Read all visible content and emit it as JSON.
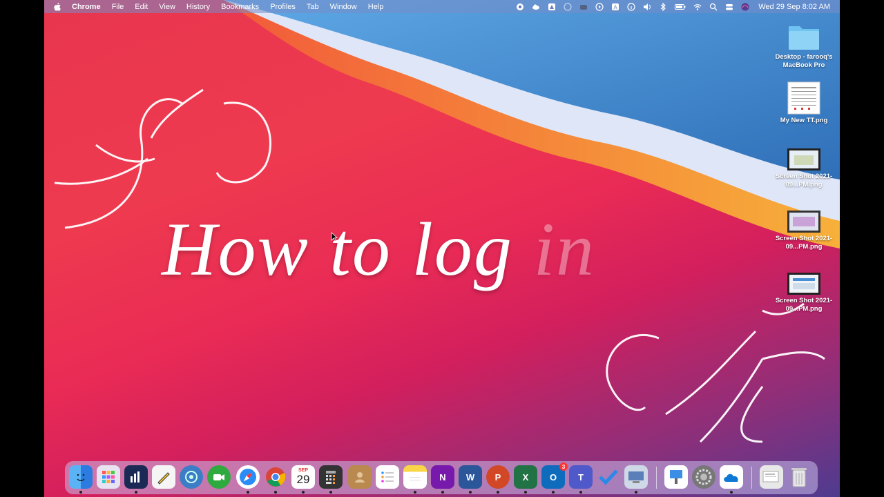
{
  "menubar": {
    "app_name": "Chrome",
    "items": [
      "File",
      "Edit",
      "View",
      "History",
      "Bookmarks",
      "Profiles",
      "Tab",
      "Window",
      "Help"
    ],
    "clock": "Wed 29 Sep  8:02 AM"
  },
  "desktop_icons": [
    {
      "label": "Desktop - farooq's MacBook Pro",
      "icon": "folder-icon"
    },
    {
      "label": "My New TT.png",
      "icon": "image-file-icon"
    },
    {
      "label": "Screen Shot 2021-09...PM.png",
      "icon": "screenshot-file-icon"
    },
    {
      "label": "Screen Shot 2021-09...PM.png",
      "icon": "screenshot-file-icon"
    },
    {
      "label": "Screen Shot 2021-09...PM.png",
      "icon": "screenshot-file-icon"
    }
  ],
  "headline": {
    "main": "How to log ",
    "faded": "in"
  },
  "dock": {
    "calendar_month": "SEP",
    "calendar_day": "29",
    "outlook_badge": "3",
    "apps": [
      "finder",
      "launchpad",
      "system-monitor",
      "preview-tool",
      "remote-desktop",
      "facetime",
      "safari",
      "chrome",
      "calendar",
      "calculator",
      "contacts",
      "reminders",
      "notes",
      "onenote",
      "word",
      "powerpoint",
      "excel",
      "outlook",
      "teams",
      "todo",
      "migration",
      "keynote",
      "system-preferences",
      "onedrive",
      "downloads",
      "trash"
    ]
  },
  "colors": {
    "menubar": "#7c8cc8",
    "wallpaper_red": "#e8364f",
    "wallpaper_blue": "#4a8fd4",
    "wallpaper_orange": "#f39a3a"
  }
}
